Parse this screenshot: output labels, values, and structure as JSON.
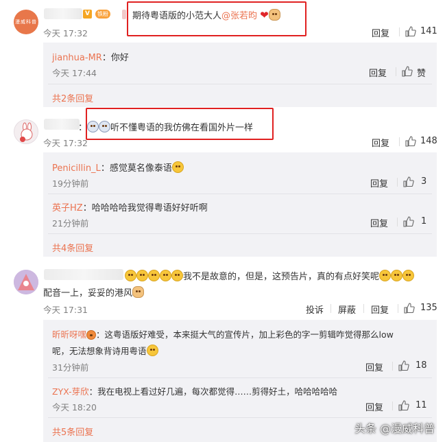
{
  "comments": [
    {
      "badge_fan": "铁粉",
      "text": "期待粤语版的小范大人",
      "mention": "@张若昀",
      "time": "今天 17:32",
      "reply_label": "回复",
      "like_count": "141",
      "replies": [
        {
          "user": "jianhua-MR",
          "text": "：你好",
          "time": "今天 17:44",
          "reply_label": "回复",
          "like_count": "赞"
        }
      ],
      "more_label": "共2条回复"
    },
    {
      "text_suffix": "：",
      "text": "听不懂粤语的我仿佛在看国外片一样",
      "time": "今天 17:32",
      "reply_label": "回复",
      "like_count": "148",
      "replies": [
        {
          "user": "Penicillin_L",
          "text": "：感觉莫名像泰语",
          "time": "19分钟前",
          "reply_label": "回复",
          "like_count": "3"
        },
        {
          "user": "英子HZ",
          "text": "：哈哈哈哈我觉得粤语好好听啊",
          "time": "21分钟前",
          "reply_label": "回复",
          "like_count": "1"
        }
      ],
      "more_label": "共4条回复"
    },
    {
      "text": "我不是故意的，但是，这预告片，真的有点好笑呢",
      "text_line2": "配音一上，妥妥的港风",
      "time": "今天 17:31",
      "report_label": "投诉",
      "block_label": "屏蔽",
      "reply_label": "回复",
      "like_count": "135",
      "replies": [
        {
          "user": "昕昕呀嘿",
          "text": "：这粤语版好难受，本来挺大气的宣传片，加上彩色的字一剪辑咋觉得那么low",
          "text_line2": "呢，无法想象背诗用粤语",
          "time": "31分钟前",
          "reply_label": "回复",
          "like_count": "18"
        },
        {
          "user": "ZYX-芽欣",
          "text": "：我在电视上看过好几遍，每次都觉得……剪得好土，哈哈哈哈哈",
          "time": "今天 18:20",
          "reply_label": "回复",
          "like_count": "11"
        }
      ],
      "more_label": "共5条回复"
    }
  ],
  "watermark": "头条 @漫威科普",
  "colors": {
    "accent": "#eb7350",
    "highlight": "#e02020",
    "reply_bg": "#f2f2f5"
  },
  "icons": [
    "thumb-up-icon",
    "smiley-emoji-icon",
    "heart-icon",
    "v-verified-icon"
  ]
}
